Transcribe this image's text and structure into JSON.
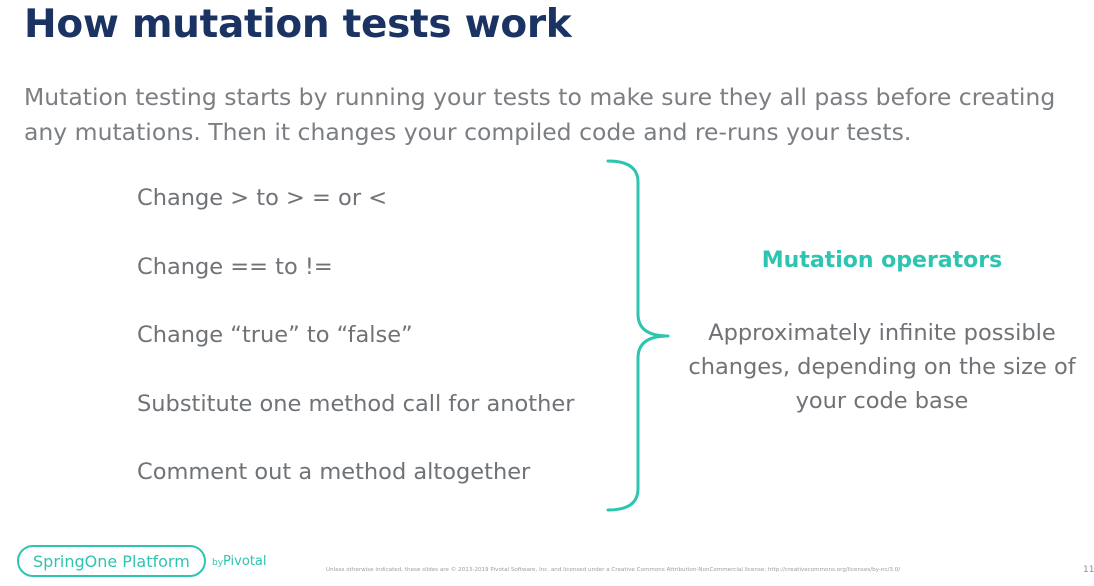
{
  "slide": {
    "title": "How mutation tests work",
    "intro_line1": "Mutation testing starts by running your tests to make sure they all pass before creating",
    "intro_line2": "any mutations. Then it changes your compiled code and re-runs your tests.",
    "operators": [
      "Change  >  to  > = or <",
      "Change  ==  to  !=",
      "Change “true” to “false”",
      "Substitute one method call for another",
      "Comment out a method altogether"
    ],
    "right_title": "Mutation operators",
    "right_lines": [
      "Approximately infinite possible",
      "changes, depending on the size of",
      "your code base"
    ]
  },
  "footer": {
    "logo_text": "SpringOne Platform",
    "by_text": "by",
    "pivotal_text": "Pivotal",
    "footnote": "Unless otherwise indicated, these slides are © 2013-2019 Pivotal Software, Inc. and licensed under a Creative Commons Attribution-NonCommercial license: http://creativecommons.org/licenses/by-nc/3.0/",
    "slide_number": "11"
  },
  "colors": {
    "title": "#1a3363",
    "accent": "#2ec5b0",
    "body_text": "#6f7377"
  }
}
